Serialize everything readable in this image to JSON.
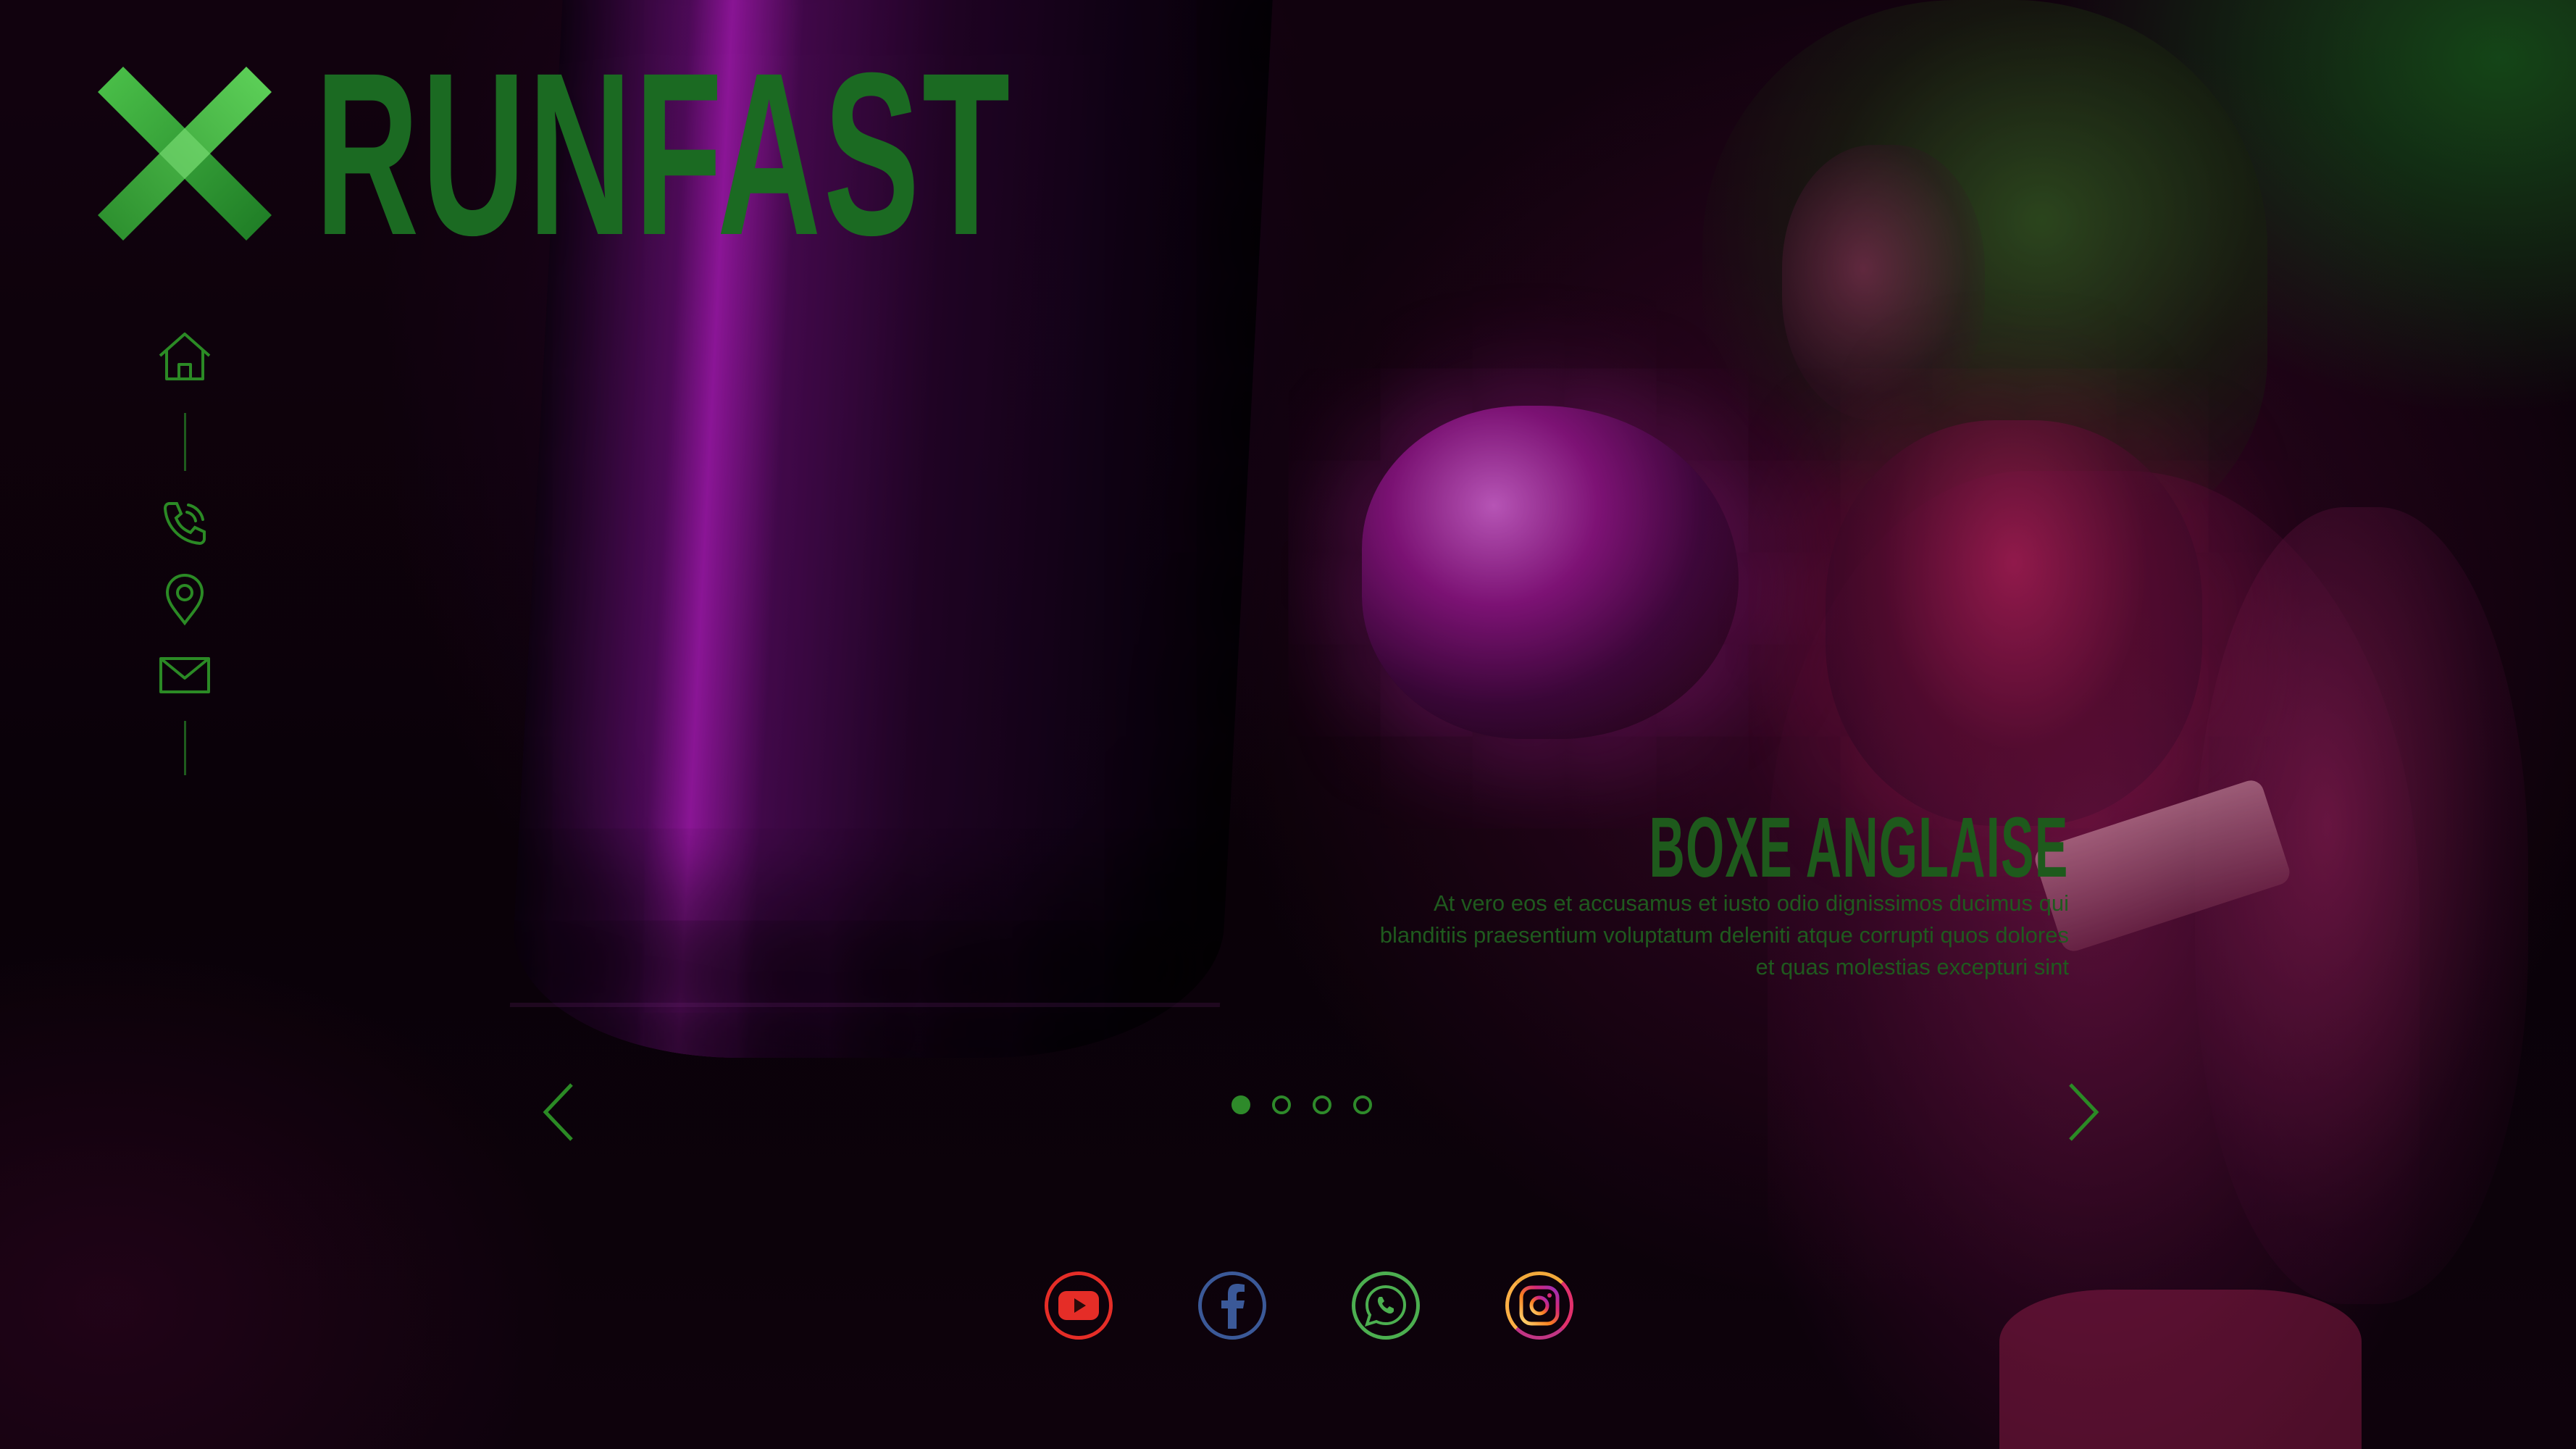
{
  "brand": {
    "name": "RUNFAST",
    "logo_icon": "x-logo-icon",
    "color": "#1b6a22"
  },
  "nav": {
    "items": [
      {
        "icon": "home-icon"
      },
      {
        "icon": "phone-icon"
      },
      {
        "icon": "location-pin-icon"
      },
      {
        "icon": "mail-icon"
      }
    ],
    "color": "#2b8a25"
  },
  "hero": {
    "title": "BOXE ANGLAISE",
    "description": "At vero eos et accusamus et iusto odio dignissimos ducimus qui blanditiis praesentium voluptatum deleniti atque corrupti quos dolores et quas molestias excepturi sint",
    "text_color": "#1e5a1c"
  },
  "slider": {
    "prev_icon": "chevron-left-icon",
    "next_icon": "chevron-right-icon",
    "slide_count": 4,
    "active_index": 0
  },
  "socials": [
    {
      "name": "youtube",
      "icon": "youtube-icon",
      "color": "#e52d27"
    },
    {
      "name": "facebook",
      "icon": "facebook-icon",
      "color": "#3b5998"
    },
    {
      "name": "whatsapp",
      "icon": "whatsapp-icon",
      "color": "#4caf50"
    },
    {
      "name": "instagram",
      "icon": "instagram-icon",
      "color": "#e1306c"
    }
  ]
}
